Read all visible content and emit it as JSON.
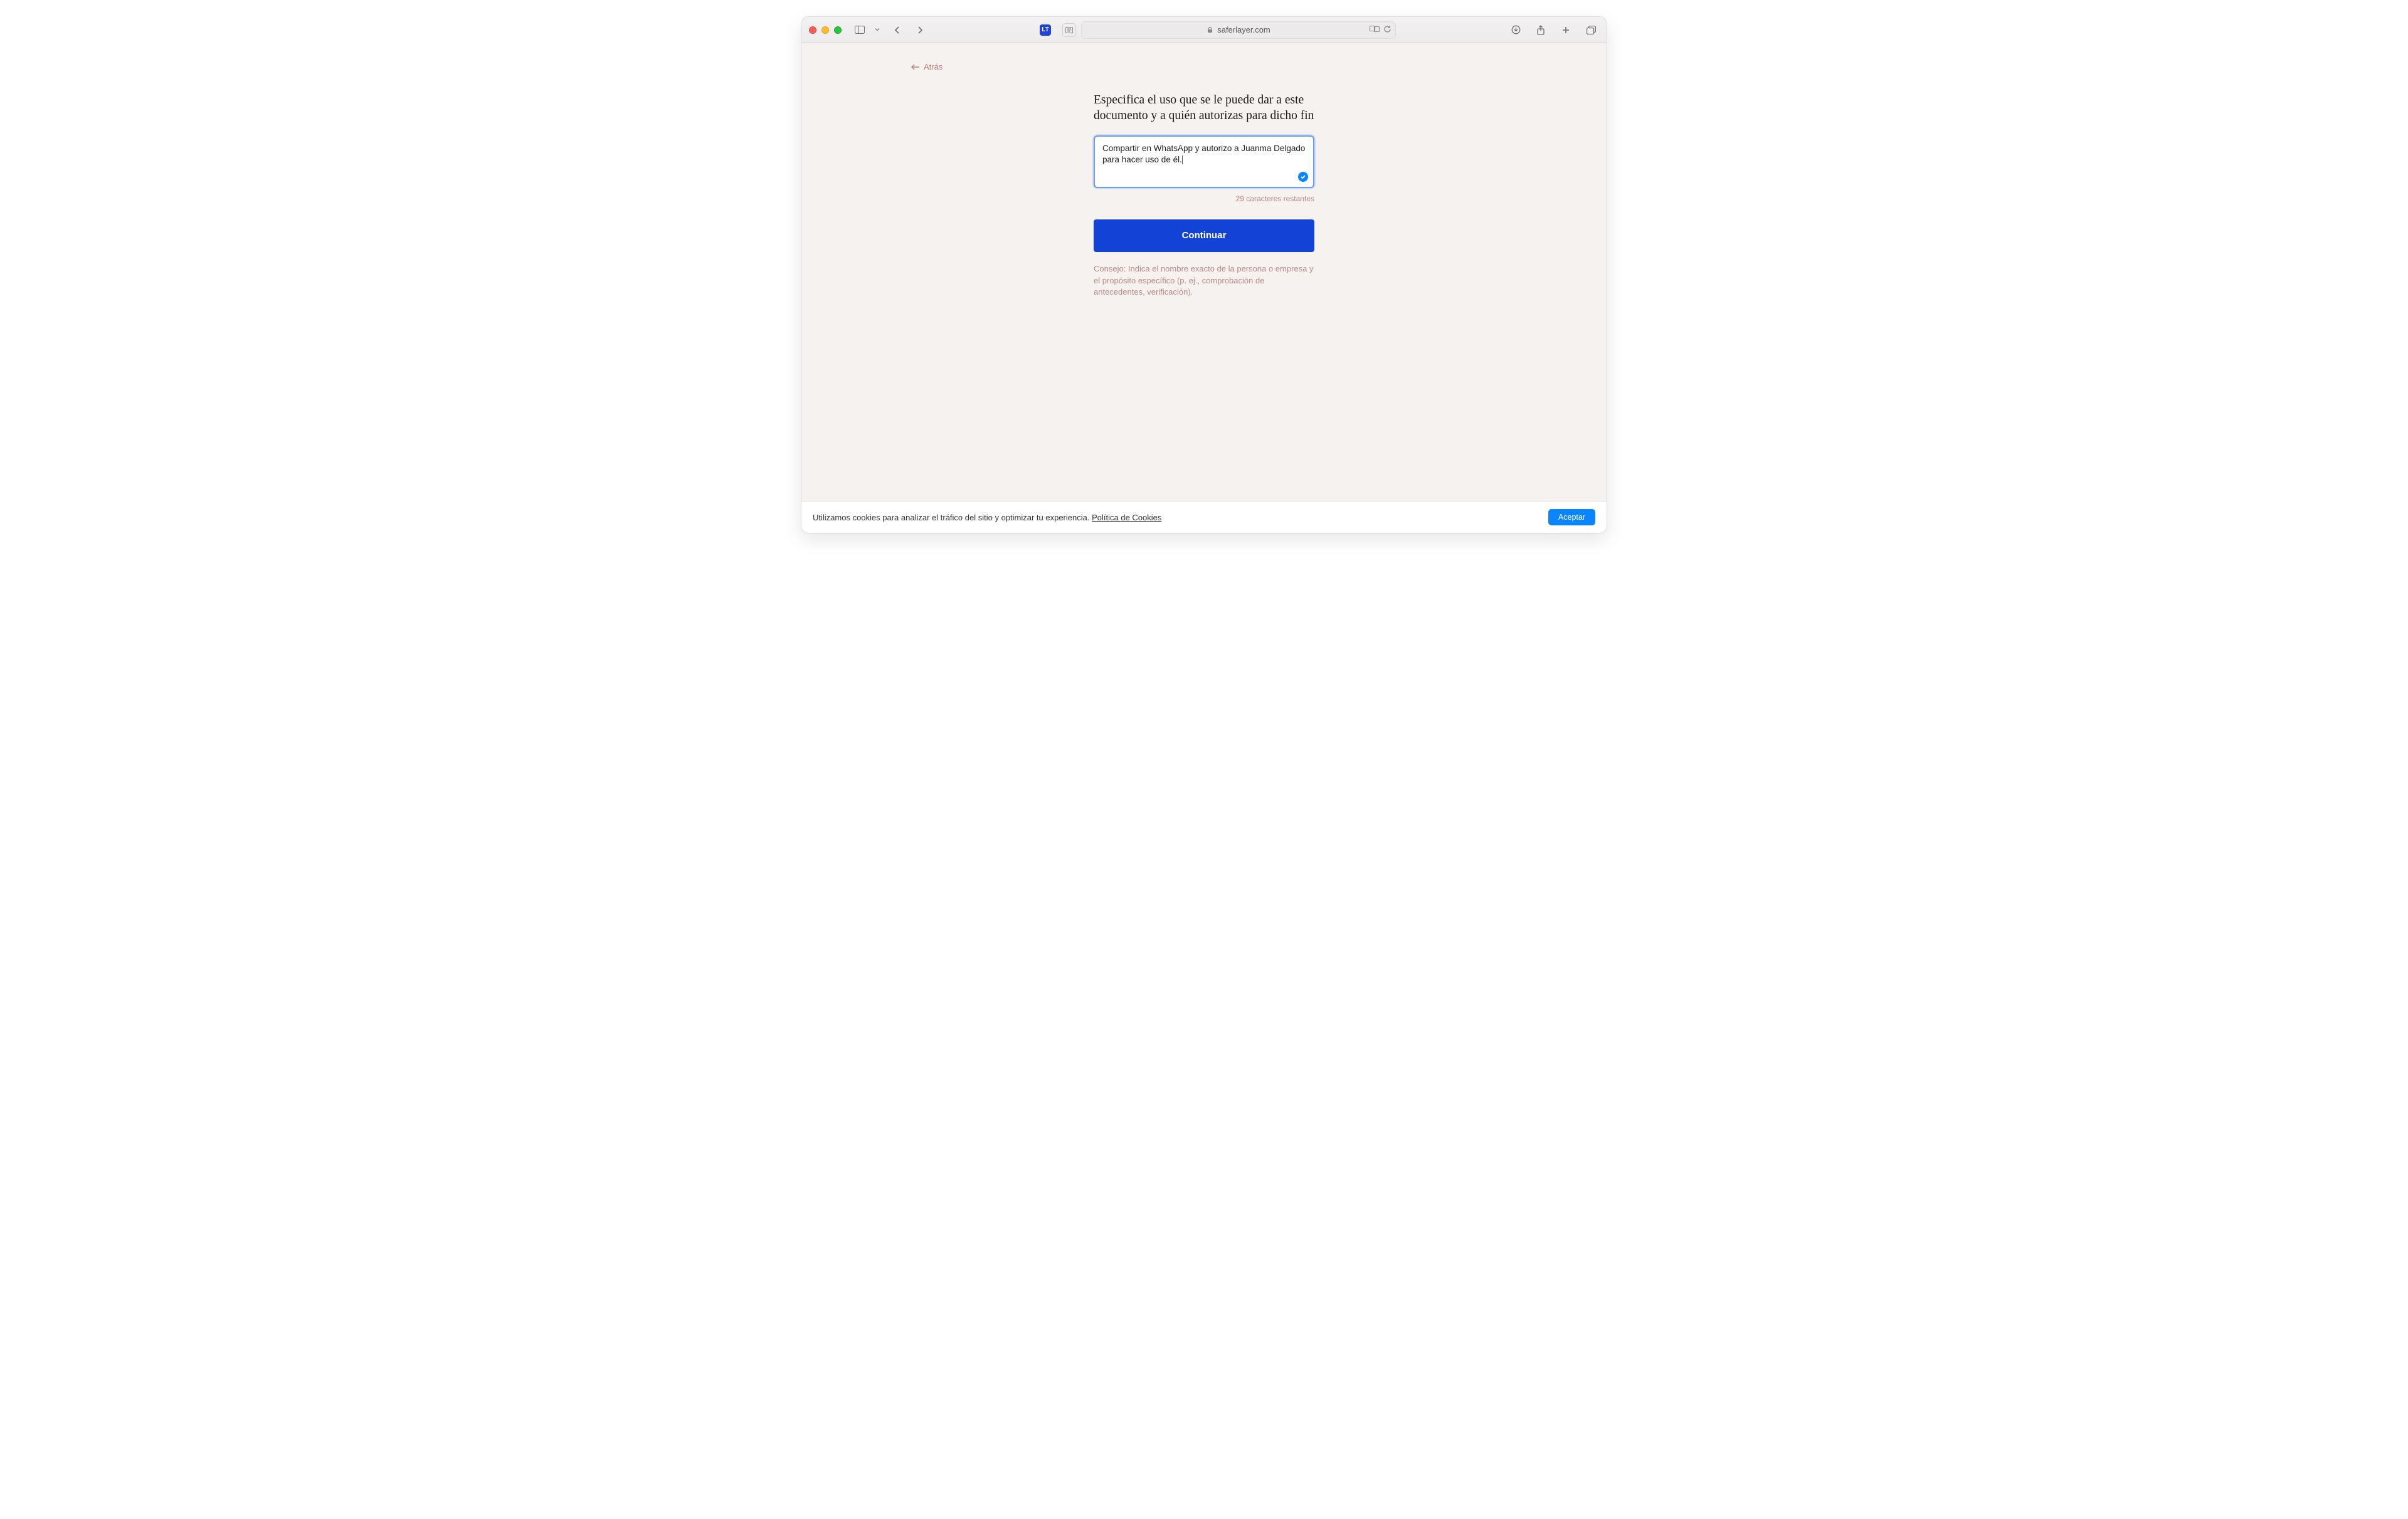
{
  "browser": {
    "url_host": "saferlayer.com",
    "lt_badge": "LT"
  },
  "page": {
    "back_label": "Atrás",
    "headline": "Especifica el uso que se le puede dar a este documento y a quién autorizas para dicho fin",
    "textarea_value": "Compartir en WhatsApp y autorizo a Juanma Delgado para hacer uso de él.",
    "char_counter": "29 caracteres restantes",
    "continue_label": "Continuar",
    "tip_text": "Consejo: Indica el nombre exacto de la persona o empresa y el propósito específico (p. ej., comprobación de antecedentes, verificación)."
  },
  "cookies": {
    "message": "Utilizamos cookies para analizar el tráfico del sitio y optimizar tu experiencia. ",
    "policy_link": "Política de Cookies",
    "accept_label": "Aceptar"
  }
}
